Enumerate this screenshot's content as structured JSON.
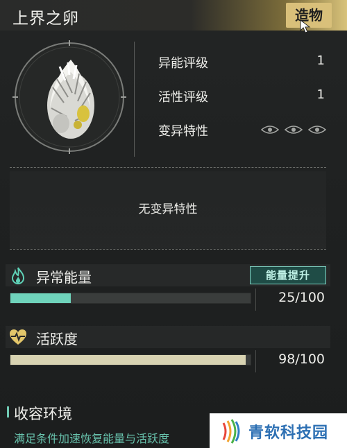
{
  "header": {
    "title": "上界之卵",
    "tab_label": "造物"
  },
  "portrait": {
    "icon": "white-feathered-egg"
  },
  "stats": [
    {
      "label": "异能评级",
      "value": "1"
    },
    {
      "label": "活性评级",
      "value": "1"
    },
    {
      "label": "变异特性",
      "icon": "three-eye-icons"
    }
  ],
  "trait": {
    "text": "无变异特性"
  },
  "energy": {
    "label": "异常能量",
    "button_label": "能量提升",
    "value_text": "25/100",
    "fraction": 0.25,
    "color": "#6fd3bb",
    "icon": "teal-flame-icon"
  },
  "activity": {
    "label": "活跃度",
    "value_text": "98/100",
    "fraction": 0.98,
    "color": "#d8d3b2",
    "icon": "heart-pulse-icon"
  },
  "footer": {
    "title": "收容环境",
    "subtitle": "满足条件加速恢复能量与活跃度"
  },
  "watermark": {
    "text": "青软科技园"
  }
}
